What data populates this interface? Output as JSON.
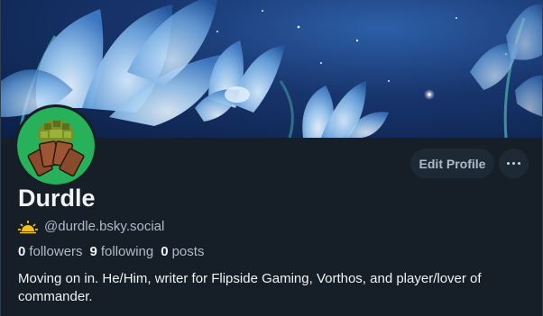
{
  "profile": {
    "display_name": "Durdle",
    "handle": "@durdle.bsky.social",
    "handle_icon": "sun-icon",
    "bio": "Moving on in. He/Him, writer for Flipside Gaming, Vorthos, and player/lover of commander."
  },
  "stats": {
    "followers_count": "0",
    "followers_label": "followers",
    "following_count": "9",
    "following_label": "following",
    "posts_count": "0",
    "posts_label": "posts"
  },
  "actions": {
    "edit_profile_label": "Edit Profile",
    "more_icon": "ellipsis-icon"
  },
  "colors": {
    "background": "#161e27",
    "button_bg": "#1e2936",
    "muted_text": "#aebbc9",
    "avatar_ring": "#27b15a"
  }
}
